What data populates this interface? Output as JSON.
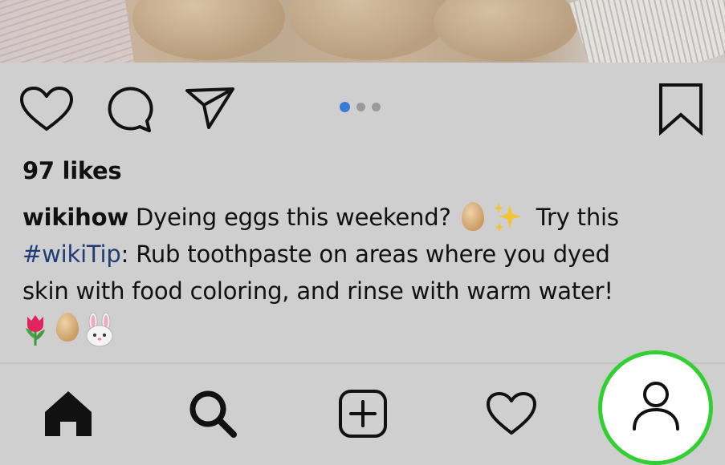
{
  "post": {
    "likes_text": "97 likes",
    "username": "wikihow",
    "caption_part1": " Dyeing eggs this weekend? ",
    "caption_part2": " Try this",
    "hashtag": "#wikiTip",
    "caption_part3": ": Rub toothpaste on areas where you dyed",
    "caption_line3": "skin with food coloring, and rinse with warm water!",
    "emojis_inline": [
      "egg",
      "sparkles"
    ],
    "emojis_trailing": [
      "tulip",
      "egg",
      "bunny"
    ],
    "carousel": {
      "count": 3,
      "active_index": 0
    }
  },
  "actions": [
    "heart-icon",
    "comment-icon",
    "share-icon",
    "bookmark-icon"
  ],
  "bottom_nav": [
    "home-icon",
    "search-icon",
    "add-icon",
    "activity-heart-icon",
    "profile-icon"
  ],
  "colors": {
    "background": "#cfcfcf",
    "hashtag": "#1f3c78",
    "carousel_active": "#3a7bd5",
    "highlight_ring": "#2fd02f"
  }
}
